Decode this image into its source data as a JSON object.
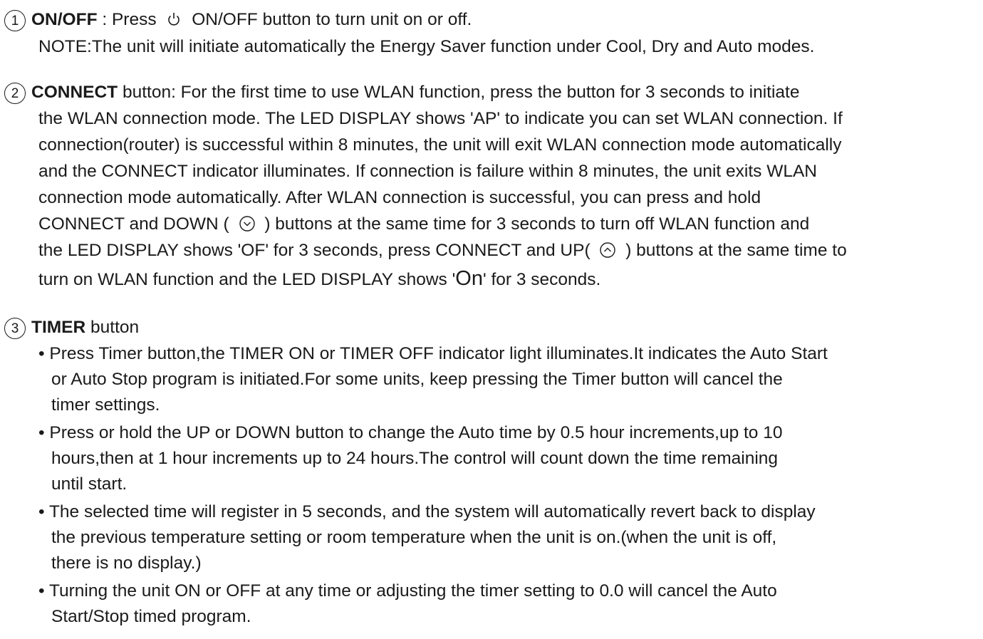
{
  "section1": {
    "number": "1",
    "title": "ON/OFF",
    "text_a": " : Press ",
    "text_b": " ON/OFF button to turn unit on or off.",
    "note": "NOTE:The unit will initiate automatically the Energy Saver function under Cool, Dry and Auto modes."
  },
  "section2": {
    "number": "2",
    "title": "CONNECT",
    "l1": " button: For the first time to use WLAN function, press  the  button for 3 seconds to initiate",
    "l2": "the WLAN connection mode. The LED DISPLAY shows 'AP' to indicate you can set WLAN connection. If",
    "l3": "connection(router) is successful within 8 minutes, the unit will exit WLAN connection mode automatically",
    "l4": "and the CONNECT indicator illuminates. If connection is failure within 8 minutes, the unit exits WLAN",
    "l5": "connection mode automatically. After WLAN connection is successful, you can press and hold",
    "l6a": "CONNECT and DOWN ( ",
    "l6b": " ) buttons at the same time for 3 seconds to turn off WLAN function and",
    "l7a": "the LED DISPLAY shows 'OF' for 3 seconds, press CONNECT and UP( ",
    "l7b": " ) buttons at the same time to",
    "l8a": " turn on WLAN function and the LED DISPLAY shows '",
    "l8_on": "On",
    "l8b": "' for 3 seconds."
  },
  "section3": {
    "number": "3",
    "title": "TIMER",
    "title_suffix": " button",
    "b1": [
      "• Press Timer button,the TIMER ON or TIMER OFF indicator light illuminates.It indicates the Auto Start",
      "or Auto Stop program is initiated.For some units, keep pressing the Timer button will cancel the",
      "timer settings."
    ],
    "b2": [
      "• Press or hold the UP or DOWN button to change the Auto time by 0.5 hour increments,up to 10",
      "hours,then at 1 hour increments up to 24 hours.The control will count down the time remaining",
      "until start."
    ],
    "b3": [
      "• The selected time will register in 5 seconds, and the system will automatically revert back to display",
      "the previous temperature setting or room temperature when the unit is on.(when the unit is off,",
      "there is no display.)"
    ],
    "b4": [
      "• Turning the unit ON or OFF at any time or adjusting the timer setting to 0.0 will cancel the Auto",
      "Start/Stop timed program."
    ]
  },
  "icons": {
    "power": "power-icon",
    "down": "chevron-down-circle-icon",
    "up": "chevron-up-circle-icon"
  }
}
